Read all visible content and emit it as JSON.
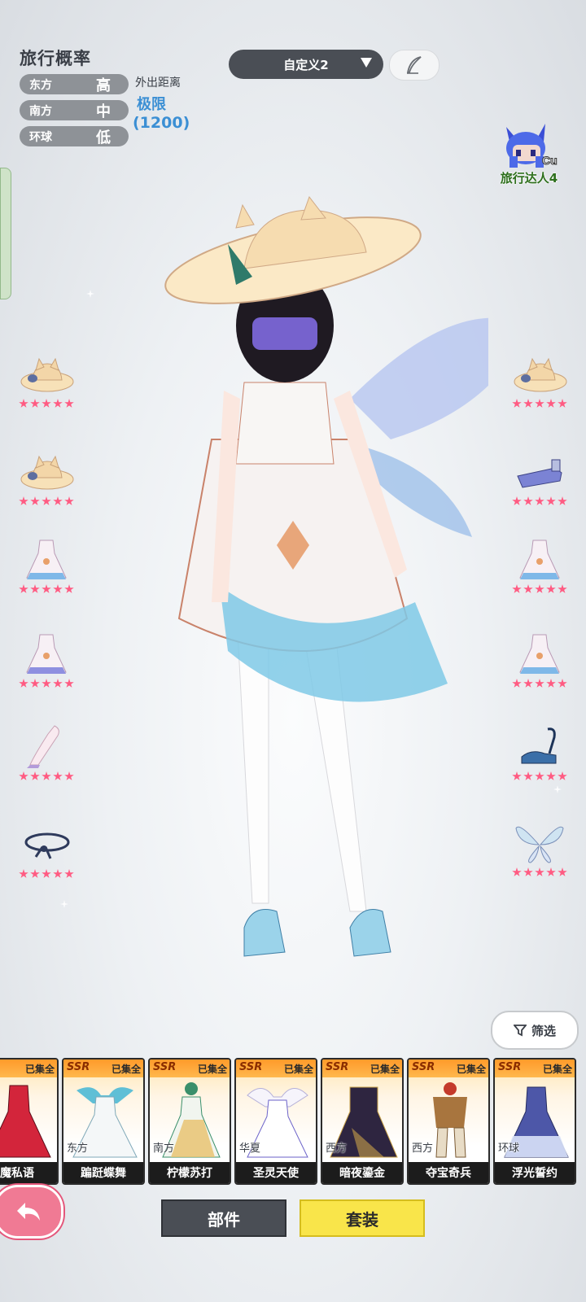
{
  "travel": {
    "title": "旅行概率",
    "rows": [
      {
        "region": "东方",
        "level": "高"
      },
      {
        "region": "南方",
        "level": "中"
      },
      {
        "region": "环球",
        "level": "低"
      }
    ],
    "out_label": "外出距离",
    "out_value": "极限",
    "out_number": "(1200)"
  },
  "preset": {
    "label": "自定义2"
  },
  "badge": {
    "letters": "Cu",
    "label": "旅行达人4"
  },
  "slots": {
    "left": [
      {
        "icon": "cat-hat-icon",
        "stars": 5
      },
      {
        "icon": "cat-hat-icon",
        "stars": 5
      },
      {
        "icon": "dress-icon",
        "stars": 5
      },
      {
        "icon": "dress-icon",
        "stars": 5
      },
      {
        "icon": "stockings-icon",
        "stars": 5
      },
      {
        "icon": "ribbon-anklet-icon",
        "stars": 5
      }
    ],
    "right": [
      {
        "icon": "cat-hat-icon",
        "stars": 5
      },
      {
        "icon": "visor-icon",
        "stars": 5
      },
      {
        "icon": "dress-icon",
        "stars": 5
      },
      {
        "icon": "dress-icon",
        "stars": 5
      },
      {
        "icon": "shoes-icon",
        "stars": 5
      },
      {
        "icon": "wings-icon",
        "stars": 5
      }
    ]
  },
  "filter": {
    "label": "筛选"
  },
  "cards": [
    {
      "rarity": "R",
      "collected": "已集全",
      "region": "",
      "name": "魔私语",
      "color": "#d3253b"
    },
    {
      "rarity": "SSR",
      "collected": "已集全",
      "region": "东方",
      "name": "蹁跹蝶舞",
      "color": "#5fbfd6"
    },
    {
      "rarity": "SSR",
      "collected": "已集全",
      "region": "南方",
      "name": "柠檬苏打",
      "color": "#3a8f6a"
    },
    {
      "rarity": "SSR",
      "collected": "已集全",
      "region": "华夏",
      "name": "圣灵天使",
      "color": "#6b62c9"
    },
    {
      "rarity": "SSR",
      "collected": "已集全",
      "region": "西方",
      "name": "暗夜鎏金",
      "color": "#2e2540"
    },
    {
      "rarity": "SSR",
      "collected": "已集全",
      "region": "西方",
      "name": "夺宝奇兵",
      "color": "#a8753e"
    },
    {
      "rarity": "SSR",
      "collected": "已集全",
      "region": "环球",
      "name": "浮光誓约",
      "color": "#4d57a8"
    }
  ],
  "tabs": {
    "parts": "部件",
    "sets": "套装"
  }
}
